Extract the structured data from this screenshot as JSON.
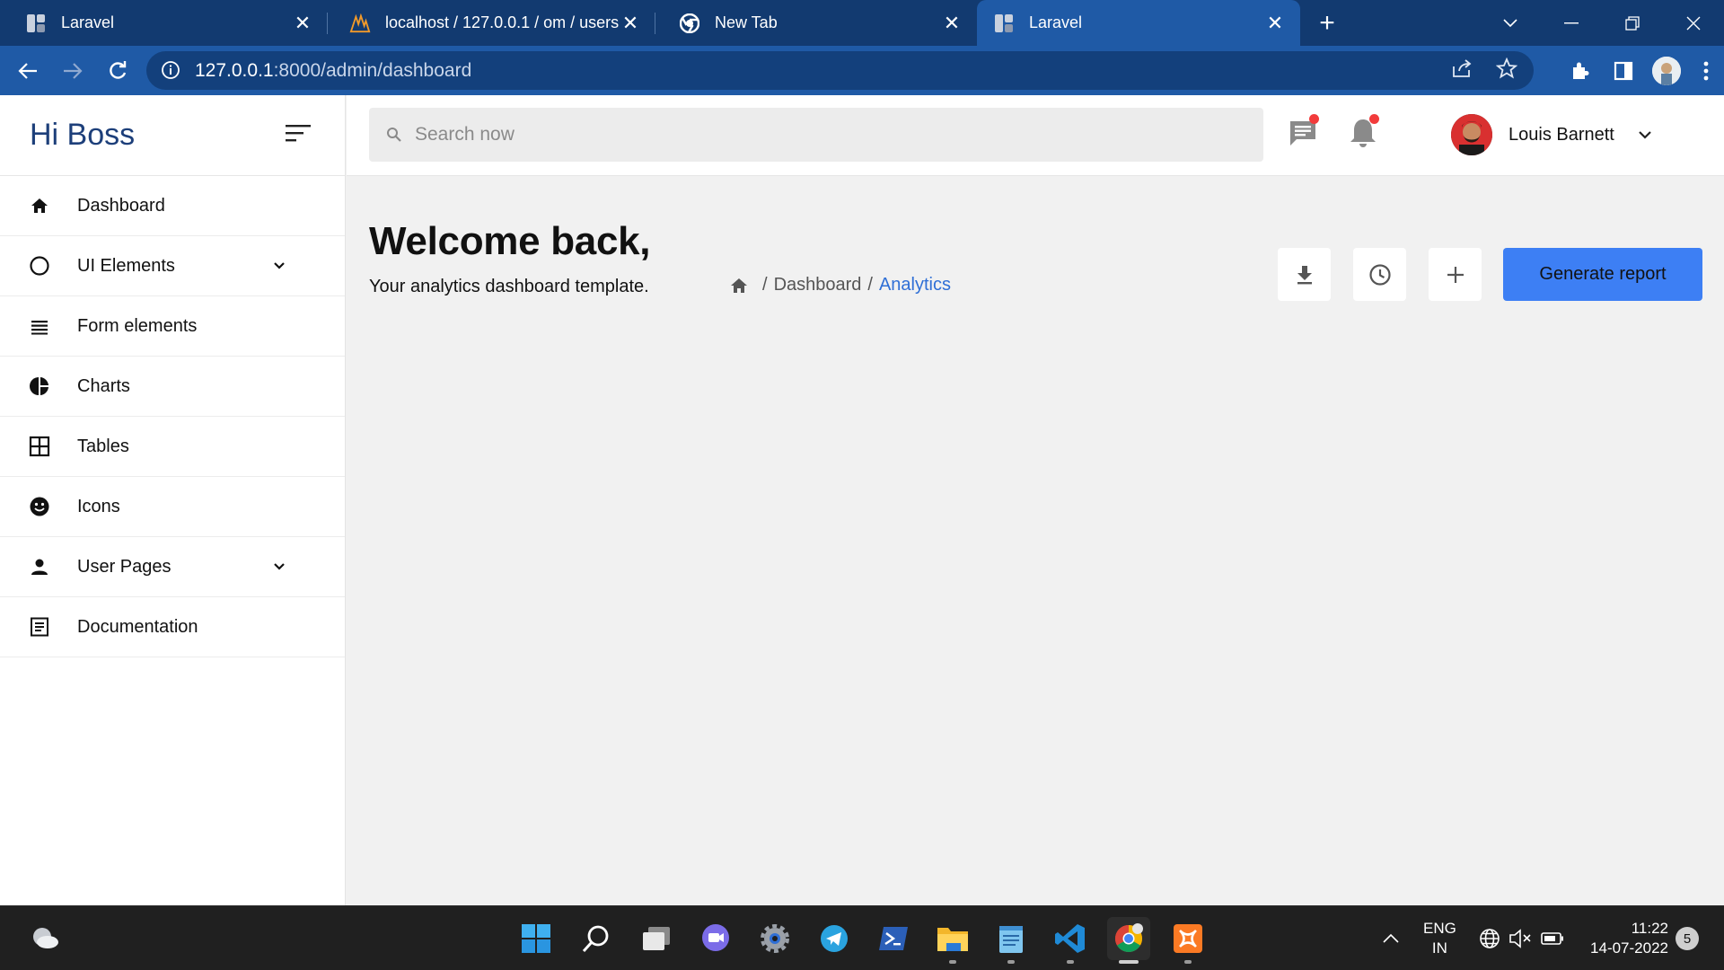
{
  "browser": {
    "tabs": [
      {
        "title": "Laravel",
        "icon": "laravel-favicon",
        "active": false
      },
      {
        "title": "localhost / 127.0.0.1 / om / users",
        "icon": "phpmyadmin-favicon",
        "active": false
      },
      {
        "title": "New Tab",
        "icon": "chrome-favicon",
        "active": false
      },
      {
        "title": "Laravel",
        "icon": "laravel-favicon",
        "active": true
      }
    ],
    "url_host": "127.0.0.1",
    "url_path": ":8000/admin/dashboard"
  },
  "sidebar": {
    "brand": "Hi Boss",
    "items": [
      {
        "label": "Dashboard",
        "icon": "home-icon",
        "expandable": false
      },
      {
        "label": "UI Elements",
        "icon": "circle-icon",
        "expandable": true
      },
      {
        "label": "Form elements",
        "icon": "list-icon",
        "expandable": false
      },
      {
        "label": "Charts",
        "icon": "pie-chart-icon",
        "expandable": false
      },
      {
        "label": "Tables",
        "icon": "table-icon",
        "expandable": false
      },
      {
        "label": "Icons",
        "icon": "smiley-icon",
        "expandable": false
      },
      {
        "label": "User Pages",
        "icon": "person-icon",
        "expandable": true
      },
      {
        "label": "Documentation",
        "icon": "document-icon",
        "expandable": false
      }
    ]
  },
  "topbar": {
    "search_placeholder": "Search now",
    "user_name": "Louis Barnett"
  },
  "main": {
    "heading": "Welcome back,",
    "subtitle": "Your analytics dashboard template.",
    "breadcrumb": {
      "sep": "/",
      "items": [
        "Dashboard",
        "Analytics"
      ]
    },
    "generate_label": "Generate report"
  },
  "taskbar": {
    "lang_line1": "ENG",
    "lang_line2": "IN",
    "time": "11:22",
    "date": "14-07-2022",
    "notification_count": "5"
  },
  "colors": {
    "accent": "#3d7ff4",
    "brand_text": "#1d3f7a",
    "tabstrip": "#123a70",
    "toolbar": "#1f5aa6"
  }
}
